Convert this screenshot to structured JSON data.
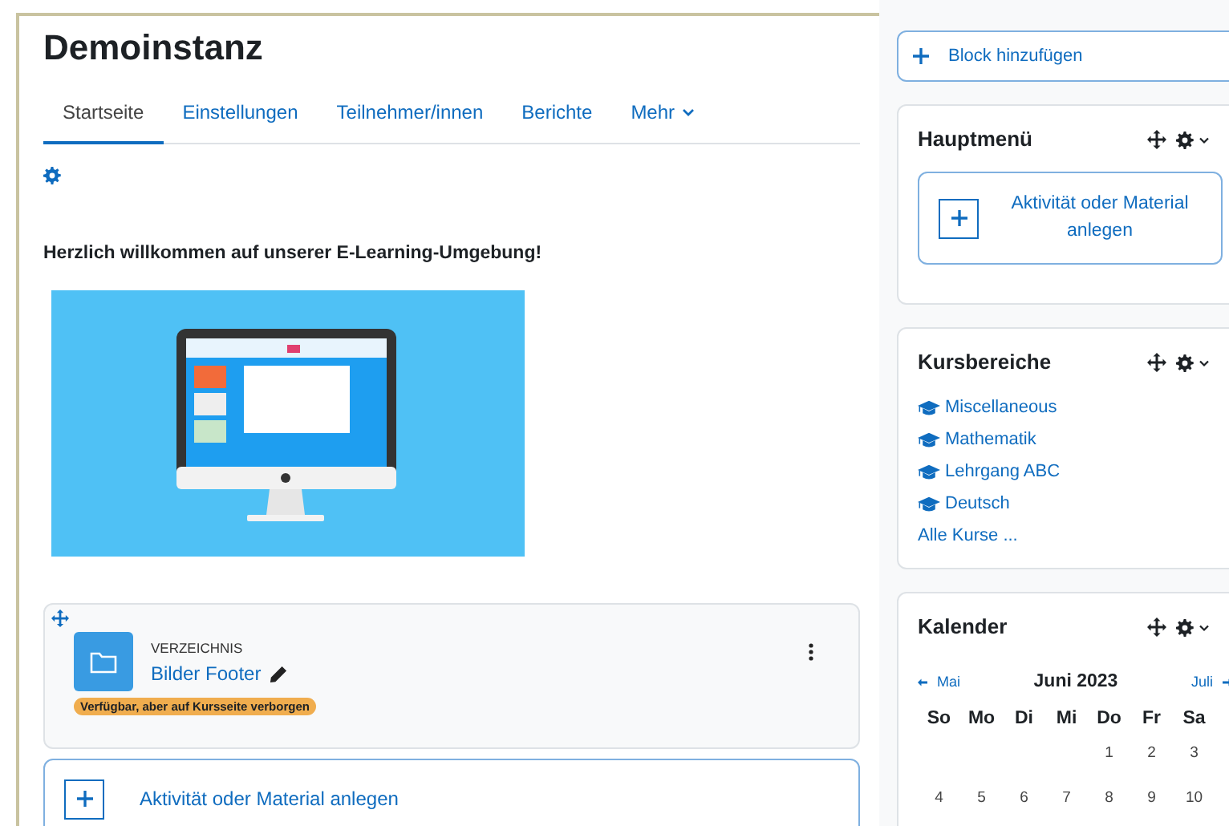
{
  "page_title": "Demoinstanz",
  "tabs": [
    {
      "label": "Startseite",
      "selected": true
    },
    {
      "label": "Einstellungen",
      "selected": false
    },
    {
      "label": "Teilnehmer/innen",
      "selected": false
    },
    {
      "label": "Berichte",
      "selected": false
    },
    {
      "label": "Mehr",
      "selected": false,
      "kind": "dropdown"
    }
  ],
  "welcome": "Herzlich willkommen auf unserer E-Learning-Umgebung!",
  "activity": {
    "type": "VERZEICHNIS",
    "name": "Bilder Footer",
    "badge": "Verfügbar, aber auf Kursseite verborgen"
  },
  "add_activity": "Aktivität oder Material anlegen",
  "block_add": "Block hinzufügen",
  "blocks": [
    {
      "kind": "menu",
      "title": "Hauptmenü",
      "button": "Aktivität oder Material anlegen"
    },
    {
      "kind": "categories",
      "title": "Kursbereiche",
      "items": [
        "Miscellaneous",
        "Mathematik",
        "Lehrgang ABC",
        "Deutsch"
      ],
      "all_link": "Alle Kurse ..."
    },
    {
      "kind": "calendar",
      "title": "Kalender",
      "prev": "Mai",
      "month": "Juni 2023",
      "next": "Juli",
      "weekdays": [
        "So",
        "Mo",
        "Di",
        "Mi",
        "Do",
        "Fr",
        "Sa"
      ],
      "weeks": [
        [
          "1",
          "2",
          "3"
        ],
        [
          "4",
          "5",
          "6",
          "7",
          "8",
          "9",
          "10"
        ]
      ]
    }
  ]
}
